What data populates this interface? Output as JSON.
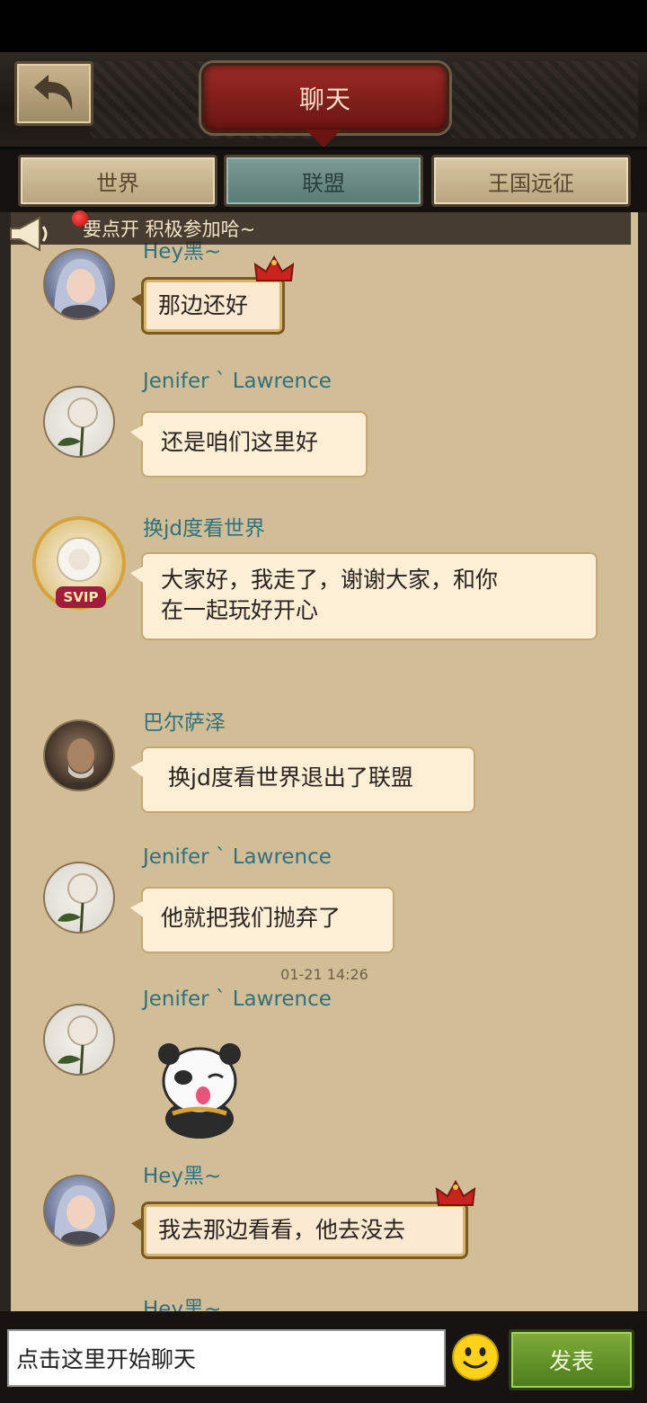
{
  "header": {
    "title": "聊天"
  },
  "tabs": [
    {
      "label": "世界",
      "active": false
    },
    {
      "label": "联盟",
      "active": true
    },
    {
      "label": "王国远征",
      "active": false
    }
  ],
  "notice": {
    "text": "要点开 积极参加哈~"
  },
  "messages": [
    {
      "name": "Hey黑~",
      "text": "那边还好"
    },
    {
      "name": "Jenifer ` Lawrence",
      "text": "还是咱们这里好"
    },
    {
      "name": "换jd度看世界",
      "text_line1": "大家好，我走了，谢谢大家，和你",
      "text_line2": "在一起玩好开心",
      "badge": "SVIP"
    },
    {
      "name": "巴尔萨泽",
      "text": "换jd度看世界退出了联盟"
    },
    {
      "name": "Jenifer ` Lawrence",
      "text": "他就把我们抛弃了"
    },
    {
      "name": "Jenifer ` Lawrence",
      "sticker": "panda-sticker"
    },
    {
      "name": "Hey黑~",
      "text": "我去那边看看，他去没去"
    },
    {
      "name": "Hey黑~"
    }
  ],
  "timestamp": "01-21 14:26",
  "input": {
    "placeholder": "点击这里开始聊天"
  },
  "send_label": "发表",
  "colors": {
    "name": "#2f7180",
    "bubble": "#fcefd6",
    "parchment": "#d1bd96",
    "title_plate": "#8a211c",
    "send_button": "#5e8d27"
  }
}
